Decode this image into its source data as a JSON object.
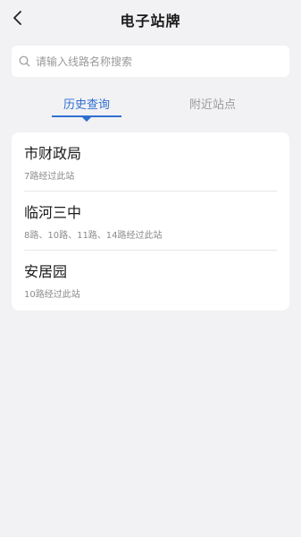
{
  "header": {
    "title": "电子站牌"
  },
  "search": {
    "placeholder": "请输入线路名称搜索",
    "value": ""
  },
  "tabs": [
    {
      "label": "历史查询",
      "active": true
    },
    {
      "label": "附近站点",
      "active": false
    }
  ],
  "stations": [
    {
      "name": "市财政局",
      "routes": "7路经过此站"
    },
    {
      "name": "临河三中",
      "routes": "8路、10路、11路、14路经过此站"
    },
    {
      "name": "安居园",
      "routes": "10路经过此站"
    }
  ],
  "colors": {
    "accent": "#2f6fd1",
    "background": "#f2f2f4",
    "card": "#ffffff",
    "muted_text": "#8a8a8a"
  }
}
